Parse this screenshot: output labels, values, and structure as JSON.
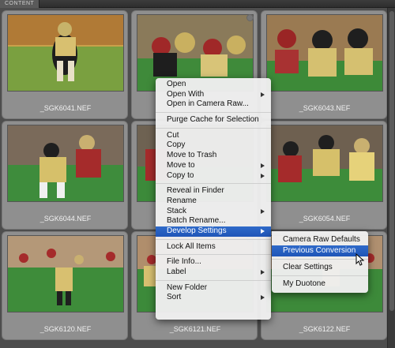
{
  "panel": {
    "tab_label": "CONTENT"
  },
  "thumbnails": [
    {
      "filename": "",
      "scene": "runner-gold"
    },
    {
      "filename": "",
      "scene": "scrum-wide"
    },
    {
      "filename": "_SGK6043.NEF",
      "scene": "scrum-tight"
    },
    {
      "filename": "_SGK6041.NEF",
      "scene": "runner-gold"
    },
    {
      "filename": "",
      "scene": "tackle"
    },
    {
      "filename": "_SGK6044.NEF",
      "scene": "tackle"
    },
    {
      "filename": "",
      "scene": "blockers"
    },
    {
      "filename": "_SGK6054.NEF",
      "scene": "blockers"
    },
    {
      "filename": "_SGK6120.NEF",
      "scene": "kickoff"
    },
    {
      "filename": "_SGK6121.NEF",
      "scene": "kickoff"
    },
    {
      "filename": "_SGK6122.NEF",
      "scene": "kickoff"
    }
  ],
  "grid_captions": {
    "row1": [
      "_SGK6041.NEF",
      "",
      "_SGK6043.NEF"
    ],
    "row2": [
      "_SGK6044.NEF",
      "",
      "_SGK6054.NEF"
    ],
    "row3": [
      "_SGK6120.NEF",
      "_SGK6121.NEF",
      "_SGK6122.NEF"
    ]
  },
  "context_menu": {
    "open": "Open",
    "open_with": "Open With",
    "open_in_camera_raw": "Open in Camera Raw...",
    "purge_cache": "Purge Cache for Selection",
    "cut": "Cut",
    "copy": "Copy",
    "move_to_trash": "Move to Trash",
    "move_to": "Move to",
    "copy_to": "Copy to",
    "reveal_in_finder": "Reveal in Finder",
    "rename": "Rename",
    "stack": "Stack",
    "batch_rename": "Batch Rename...",
    "develop_settings": "Develop Settings",
    "lock_all_items": "Lock All Items",
    "file_info": "File Info...",
    "label": "Label",
    "new_folder": "New Folder",
    "sort": "Sort"
  },
  "submenu": {
    "camera_raw_defaults": "Camera Raw Defaults",
    "previous_conversion": "Previous Conversion",
    "clear_settings": "Clear Settings",
    "my_duotone": "My Duotone"
  },
  "colors": {
    "highlight": "#2a62c4",
    "cell": "#8f8f8f",
    "background": "#4d4d4d"
  }
}
